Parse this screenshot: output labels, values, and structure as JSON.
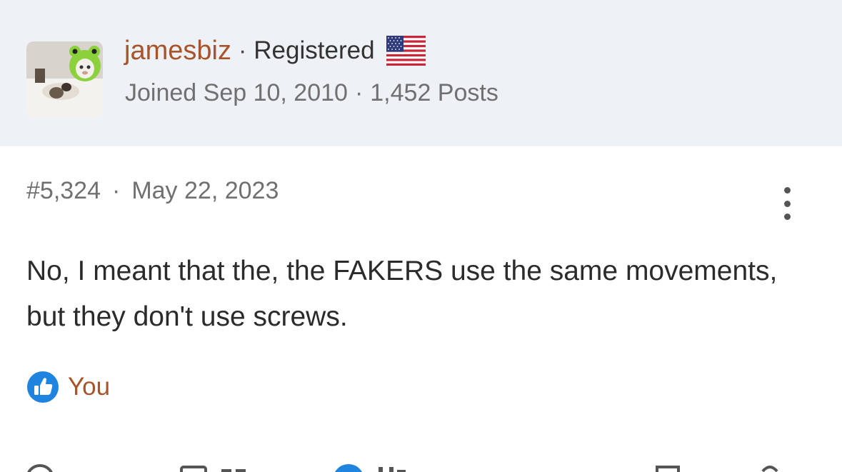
{
  "user": {
    "username": "jamesbiz",
    "separator": "·",
    "role": "Registered",
    "flag": "us-flag-icon",
    "joined": "Joined Sep 10, 2010",
    "posts": "1,452 Posts"
  },
  "post": {
    "number": "#5,324",
    "date": "May 22, 2023",
    "body": "No, I meant that the, the FAKERS use the same movements, but they don't use screws.",
    "more_icon": "more-vertical-icon"
  },
  "reactions": {
    "icon": "like-icon",
    "label": "You"
  },
  "colors": {
    "header_bg": "#eef1f5",
    "username": "#a9532a",
    "like_badge": "#1f84e0",
    "muted_text": "#707070"
  }
}
